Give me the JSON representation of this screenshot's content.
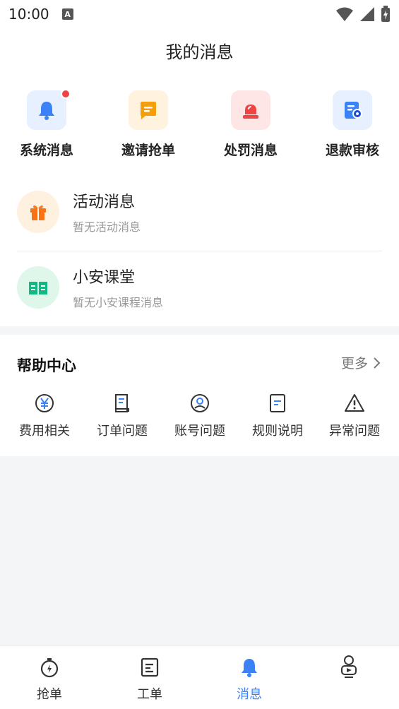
{
  "status_bar": {
    "time": "10:00",
    "a_badge": "A"
  },
  "page_title": "我的消息",
  "quick_actions": [
    {
      "label": "系统消息",
      "icon": "bell-icon",
      "color": "#3b82f6",
      "bg": "#e6f0ff",
      "has_badge": true
    },
    {
      "label": "邀请抢单",
      "icon": "chat-icon",
      "color": "#f59e0b",
      "bg": "#fff2df"
    },
    {
      "label": "处罚消息",
      "icon": "alarm-icon",
      "color": "#ef4444",
      "bg": "#ffe6e6"
    },
    {
      "label": "退款审核",
      "icon": "refund-icon",
      "color": "#3b82f6",
      "bg": "#e6f0ff"
    }
  ],
  "messages": [
    {
      "title": "活动消息",
      "subtitle": "暂无活动消息",
      "icon": "gift-icon",
      "color": "#f97316",
      "bg": "#fff1e0"
    },
    {
      "title": "小安课堂",
      "subtitle": "暂无小安课程消息",
      "icon": "book-icon",
      "color": "#10b981",
      "bg": "#def7ea"
    }
  ],
  "help_center": {
    "title": "帮助中心",
    "more_label": "更多",
    "items": [
      {
        "label": "费用相关",
        "icon": "yen-icon"
      },
      {
        "label": "订单问题",
        "icon": "document-icon"
      },
      {
        "label": "账号问题",
        "icon": "user-circle-icon"
      },
      {
        "label": "规则说明",
        "icon": "rules-icon"
      },
      {
        "label": "异常问题",
        "icon": "warning-icon"
      }
    ]
  },
  "tabs": [
    {
      "label": "抢单",
      "icon": "stopwatch-icon",
      "active": false
    },
    {
      "label": "工单",
      "icon": "worksheet-icon",
      "active": false
    },
    {
      "label": "消息",
      "icon": "bell-icon",
      "active": true
    },
    {
      "label": "",
      "icon": "profile-icon",
      "active": false
    }
  ],
  "colors": {
    "accent": "#3b82f6",
    "badge": "#ef4444",
    "background": "#f4f5f7"
  }
}
